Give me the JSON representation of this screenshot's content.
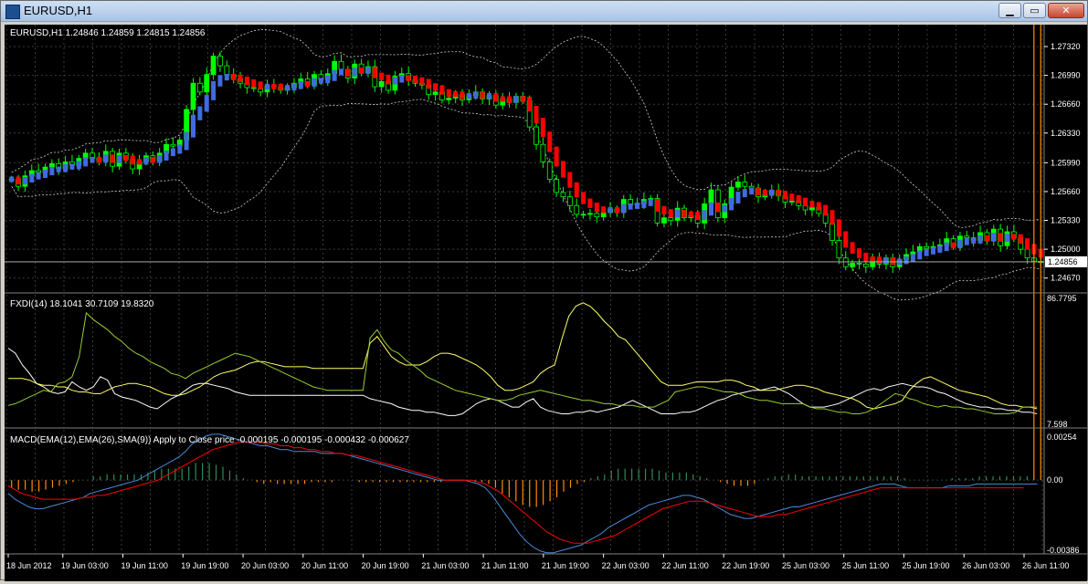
{
  "window": {
    "title": "EURUSD,H1",
    "buttons": {
      "minimize": "▁",
      "restore": "▭",
      "close": "✕"
    }
  },
  "colors": {
    "background": "#000000",
    "grid": "#3a3a3a",
    "axis_text": "#ffffff",
    "bull": "#00ff00",
    "bear": "#000000",
    "ha_up": "#4169e1",
    "ha_down": "#ff0000",
    "bands": "#d0d0d0",
    "fxdi_a": "#ffffff",
    "fxdi_b": "#ffff66",
    "fxdi_c": "#9acd32",
    "macd_main": "#4a8ad8",
    "macd_signal": "#ff0000",
    "hist_up": "#2e8b57",
    "hist_down": "#ff8c00"
  },
  "chart_data": [
    {
      "type": "candlestick",
      "label": "EURUSD,H1  1.24846 1.24859 1.24815 1.24856",
      "current_price": "1.24856",
      "ylim": [
        1.245,
        1.2755
      ],
      "y_ticks": [
        "1.27320",
        "1.26990",
        "1.26660",
        "1.26330",
        "1.25990",
        "1.25660",
        "1.25330",
        "1.25000",
        "1.24670"
      ],
      "x_ticks": [
        "18 Jun 2012",
        "19 Jun 03:00",
        "19 Jun 11:00",
        "19 Jun 19:00",
        "20 Jun 03:00",
        "20 Jun 11:00",
        "20 Jun 19:00",
        "21 Jun 03:00",
        "21 Jun 11:00",
        "21 Jun 19:00",
        "22 Jun 03:00",
        "22 Jun 11:00",
        "22 Jun 19:00",
        "25 Jun 03:00",
        "25 Jun 11:00",
        "25 Jun 19:00",
        "26 Jun 03:00",
        "26 Jun 11:00"
      ],
      "close": [
        1.258,
        1.2572,
        1.2584,
        1.259,
        1.2588,
        1.2594,
        1.2598,
        1.2592,
        1.26,
        1.2596,
        1.2604,
        1.261,
        1.2604,
        1.2601,
        1.2612,
        1.2595,
        1.261,
        1.2603,
        1.2592,
        1.26,
        1.2607,
        1.2601,
        1.261,
        1.262,
        1.2618,
        1.2625,
        1.266,
        1.269,
        1.268,
        1.27,
        1.2721,
        1.271,
        1.27,
        1.2695,
        1.269,
        1.2685,
        1.2684,
        1.268,
        1.2687,
        1.2686,
        1.2682,
        1.2685,
        1.269,
        1.2695,
        1.2688,
        1.27,
        1.2694,
        1.2701,
        1.2715,
        1.2706,
        1.2696,
        1.2712,
        1.2702,
        1.2709,
        1.2686,
        1.2692,
        1.2682,
        1.2698,
        1.2701,
        1.2694,
        1.269,
        1.2688,
        1.2677,
        1.268,
        1.2671,
        1.2673,
        1.2677,
        1.2671,
        1.2676,
        1.268,
        1.2672,
        1.2676,
        1.2665,
        1.2672,
        1.2668,
        1.2675,
        1.267,
        1.264,
        1.262,
        1.26,
        1.258,
        1.2565,
        1.256,
        1.255,
        1.254,
        1.254,
        1.2541,
        1.2537,
        1.2542,
        1.2546,
        1.2543,
        1.2557,
        1.2551,
        1.2552,
        1.2557,
        1.2558,
        1.253,
        1.2536,
        1.2533,
        1.2547,
        1.2536,
        1.2539,
        1.253,
        1.2552,
        1.2568,
        1.2536,
        1.2552,
        1.2571,
        1.2577,
        1.2572,
        1.257,
        1.256,
        1.2563,
        1.2567,
        1.2561,
        1.2554,
        1.2555,
        1.255,
        1.2545,
        1.2548,
        1.2541,
        1.253,
        1.251,
        1.249,
        1.248,
        1.2484,
        1.2483,
        1.248,
        1.2488,
        1.2483,
        1.249,
        1.248,
        1.2488,
        1.2494,
        1.2497,
        1.2503,
        1.2501,
        1.2503,
        1.2505,
        1.2512,
        1.2503,
        1.2515,
        1.2513,
        1.251,
        1.2519,
        1.251,
        1.2523,
        1.2504,
        1.252,
        1.2513,
        1.25,
        1.249,
        1.2486,
        1.2486
      ],
      "high_max": 1.274,
      "low_min": 1.2455
    },
    {
      "type": "line",
      "label": "FXDI(14) 18.1041 30.7109 19.8320",
      "ylim": [
        7.598,
        86.7795
      ],
      "y_ticks": [
        "86.7795",
        "7.598"
      ],
      "series": [
        {
          "name": "FXDI main",
          "values": [
            55,
            52,
            45,
            40,
            34,
            32,
            29,
            28,
            29,
            35,
            32,
            30,
            32,
            38,
            36,
            28,
            26,
            25,
            24,
            22,
            20,
            19,
            22,
            25,
            27,
            30,
            33,
            34,
            34,
            33,
            32,
            31,
            29,
            28,
            27,
            27,
            27,
            27,
            27,
            27,
            27,
            27,
            27,
            27,
            27,
            27,
            27,
            27,
            27,
            27,
            27,
            25,
            24,
            23,
            22,
            20,
            19,
            18,
            18,
            17,
            17,
            16,
            15,
            15,
            16,
            19,
            22,
            24,
            25,
            24,
            22,
            20,
            20,
            23,
            25,
            20,
            18,
            17,
            16,
            16,
            17,
            17,
            18,
            17,
            18,
            19,
            20,
            22,
            24,
            22,
            20,
            18,
            16,
            16,
            16,
            17,
            17,
            18,
            20,
            22,
            24,
            25,
            27,
            28,
            29,
            30,
            30,
            31,
            32,
            30,
            28,
            25,
            22,
            20,
            20,
            20,
            21,
            22,
            24,
            26,
            28,
            30,
            31,
            30,
            32,
            33,
            34,
            33,
            32,
            32,
            31,
            29,
            28,
            26,
            24,
            22,
            21,
            20,
            20,
            19,
            19,
            18,
            18,
            17,
            17,
            16
          ]
        },
        {
          "name": "FXDI +DI",
          "values": [
            37,
            37,
            37,
            36,
            34,
            33,
            33,
            32,
            32,
            30,
            29,
            29,
            28,
            28,
            30,
            32,
            33,
            34,
            34,
            33,
            32,
            30,
            28,
            27,
            27,
            28,
            30,
            32,
            35,
            38,
            40,
            41,
            42,
            44,
            46,
            47,
            47,
            46,
            45,
            44,
            44,
            44,
            44,
            43,
            43,
            43,
            43,
            43,
            43,
            43,
            43,
            58,
            62,
            56,
            50,
            47,
            45,
            45,
            45,
            47,
            50,
            52,
            52,
            51,
            49,
            47,
            45,
            42,
            38,
            33,
            30,
            30,
            31,
            33,
            35,
            40,
            43,
            45,
            60,
            74,
            80,
            82,
            80,
            76,
            71,
            67,
            62,
            60,
            55,
            50,
            45,
            40,
            35,
            33,
            33,
            33,
            34,
            35,
            35,
            35,
            35,
            36,
            36,
            35,
            33,
            32,
            30,
            30,
            30,
            31,
            32,
            33,
            33,
            32,
            31,
            29,
            28,
            27,
            26,
            25,
            23,
            20,
            19,
            20,
            21,
            22,
            24,
            30,
            34,
            37,
            38,
            36,
            34,
            32,
            30,
            29,
            28,
            27,
            26,
            24,
            22,
            21,
            21,
            20,
            20,
            19
          ]
        },
        {
          "name": "FXDI -DI",
          "values": [
            21,
            22,
            24,
            26,
            28,
            30,
            29,
            34,
            35,
            38,
            50,
            76,
            72,
            69,
            66,
            62,
            59,
            55,
            52,
            50,
            47,
            45,
            43,
            40,
            39,
            37,
            40,
            42,
            44,
            46,
            48,
            50,
            52,
            51,
            50,
            48,
            46,
            44,
            42,
            40,
            38,
            36,
            34,
            32,
            31,
            30,
            30,
            30,
            30,
            30,
            30,
            61,
            66,
            59,
            54,
            52,
            48,
            45,
            42,
            38,
            36,
            34,
            32,
            30,
            29,
            28,
            27,
            26,
            25,
            24,
            24,
            25,
            27,
            28,
            29,
            30,
            29,
            28,
            27,
            26,
            25,
            24,
            24,
            23,
            22,
            22,
            21,
            21,
            21,
            20,
            20,
            20,
            22,
            24,
            29,
            30,
            31,
            32,
            32,
            31,
            30,
            29,
            29,
            28,
            26,
            25,
            24,
            24,
            23,
            22,
            22,
            22,
            22,
            20,
            19,
            19,
            18,
            17,
            17,
            16,
            16,
            17,
            19,
            22,
            25,
            28,
            27,
            25,
            24,
            22,
            21,
            20,
            21,
            20,
            20,
            19,
            19,
            18,
            17,
            16,
            16,
            16,
            17,
            20,
            20,
            20
          ]
        }
      ]
    },
    {
      "type": "bar+line",
      "label": "MACD(EMA(12),EMA(26),SMA(9)) Apply to Close price -0.000195 -0.000195 -0.000432 -0.000627",
      "ylim": [
        -0.00386,
        0.00254
      ],
      "y_ticks": [
        "0.00254",
        "0.00",
        "-0.00386"
      ],
      "series": [
        {
          "name": "MACD main",
          "values": [
            -0.0007,
            -0.001,
            -0.0012,
            -0.0014,
            -0.0015,
            -0.0015,
            -0.0014,
            -0.0013,
            -0.0012,
            -0.0011,
            -0.001,
            -0.0009,
            -0.0007,
            -0.0006,
            -0.0005,
            -0.0004,
            -0.0003,
            -0.0002,
            -0.0001,
            0.0,
            0.0002,
            0.0004,
            0.0006,
            0.0008,
            0.001,
            0.0012,
            0.0015,
            0.0019,
            0.0021,
            0.0023,
            0.0024,
            0.0024,
            0.0023,
            0.0022,
            0.0021,
            0.002,
            0.0019,
            0.0018,
            0.0018,
            0.0017,
            0.0016,
            0.0016,
            0.0015,
            0.0015,
            0.0015,
            0.0015,
            0.0014,
            0.0014,
            0.0014,
            0.0014,
            0.0013,
            0.0012,
            0.0011,
            0.001,
            0.0009,
            0.0008,
            0.0007,
            0.0006,
            0.0005,
            0.0004,
            0.0003,
            0.0002,
            0.0001,
            0.0,
            0.0,
            0.0,
            0.0,
            0.0,
            -0.0001,
            -0.0002,
            -0.0004,
            -0.0008,
            -0.0013,
            -0.0018,
            -0.0023,
            -0.0028,
            -0.0032,
            -0.0035,
            -0.0037,
            -0.0038,
            -0.0038,
            -0.0037,
            -0.0036,
            -0.0035,
            -0.0034,
            -0.0032,
            -0.003,
            -0.0028,
            -0.0025,
            -0.0023,
            -0.0021,
            -0.0019,
            -0.0017,
            -0.0015,
            -0.0013,
            -0.0012,
            -0.0011,
            -0.001,
            -0.0009,
            -0.0008,
            -0.0008,
            -0.0009,
            -0.001,
            -0.0012,
            -0.0014,
            -0.0016,
            -0.0018,
            -0.0019,
            -0.002,
            -0.002,
            -0.0019,
            -0.0018,
            -0.0017,
            -0.0016,
            -0.0015,
            -0.0014,
            -0.0014,
            -0.0013,
            -0.0012,
            -0.0011,
            -0.001,
            -0.0009,
            -0.0008,
            -0.0007,
            -0.0006,
            -0.0005,
            -0.0004,
            -0.0003,
            -0.0002,
            -0.0002,
            -0.0002,
            -0.0003,
            -0.0004,
            -0.0004,
            -0.0004,
            -0.0004,
            -0.0004,
            -0.0004,
            -0.0003,
            -0.0003,
            -0.0003,
            -0.0003,
            -0.0002,
            -0.0002,
            -0.0002,
            -0.0002,
            -0.0002,
            -0.0002,
            -0.0002,
            -0.0002,
            -0.0002,
            -0.0002
          ]
        },
        {
          "name": "MACD signal",
          "values": [
            -0.0003,
            -0.0005,
            -0.0007,
            -0.0008,
            -0.0009,
            -0.001,
            -0.001,
            -0.001,
            -0.001,
            -0.001,
            -0.001,
            -0.0009,
            -0.0009,
            -0.0008,
            -0.0008,
            -0.0007,
            -0.0006,
            -0.0005,
            -0.0004,
            -0.0003,
            -0.0002,
            -0.0001,
            0.0,
            0.0002,
            0.0004,
            0.0006,
            0.0008,
            0.001,
            0.0012,
            0.0014,
            0.0016,
            0.0017,
            0.0018,
            0.0019,
            0.002,
            0.002,
            0.002,
            0.002,
            0.0019,
            0.0019,
            0.0018,
            0.0018,
            0.0017,
            0.0017,
            0.0016,
            0.0016,
            0.0015,
            0.0015,
            0.0014,
            0.0014,
            0.0013,
            0.0013,
            0.0012,
            0.0011,
            0.001,
            0.0009,
            0.0008,
            0.0007,
            0.0006,
            0.0005,
            0.0004,
            0.0003,
            0.0002,
            0.0001,
            0.0,
            0.0,
            0.0,
            0.0,
            0.0,
            -0.0001,
            -0.0002,
            -0.0004,
            -0.0006,
            -0.0009,
            -0.0012,
            -0.0015,
            -0.0018,
            -0.0021,
            -0.0024,
            -0.0027,
            -0.0029,
            -0.0031,
            -0.0032,
            -0.0033,
            -0.0033,
            -0.0033,
            -0.0032,
            -0.0031,
            -0.003,
            -0.0029,
            -0.0027,
            -0.0025,
            -0.0023,
            -0.0021,
            -0.0019,
            -0.0017,
            -0.0015,
            -0.0014,
            -0.0013,
            -0.0012,
            -0.0011,
            -0.0011,
            -0.0011,
            -0.0012,
            -0.0013,
            -0.0014,
            -0.0015,
            -0.0016,
            -0.0017,
            -0.0018,
            -0.0019,
            -0.0019,
            -0.0019,
            -0.0018,
            -0.0018,
            -0.0017,
            -0.0016,
            -0.0015,
            -0.0014,
            -0.0013,
            -0.0012,
            -0.0011,
            -0.001,
            -0.0009,
            -0.0008,
            -0.0007,
            -0.0006,
            -0.0005,
            -0.0004,
            -0.0004,
            -0.0004,
            -0.0004,
            -0.0004,
            -0.0004,
            -0.0004,
            -0.0004,
            -0.0004,
            -0.0004,
            -0.0004,
            -0.0004,
            -0.0004,
            -0.0004,
            -0.0004,
            -0.0004,
            -0.0004,
            -0.0004,
            -0.0004,
            -0.0004,
            -0.0004,
            -0.0004
          ]
        }
      ]
    }
  ]
}
